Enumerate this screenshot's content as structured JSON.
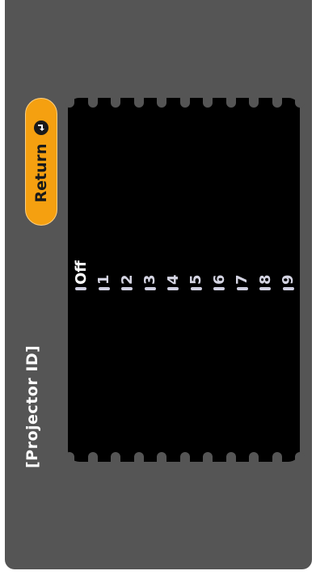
{
  "screen": {
    "title": "[Projector ID]",
    "return_button": {
      "label": "Return",
      "icon": "enter-icon"
    },
    "list": {
      "selected": "Off",
      "items": [
        {
          "label": "Off",
          "selected": true
        },
        {
          "label": "1",
          "selected": false
        },
        {
          "label": "2",
          "selected": false
        },
        {
          "label": "3",
          "selected": false
        },
        {
          "label": "4",
          "selected": false
        },
        {
          "label": "5",
          "selected": false
        },
        {
          "label": "6",
          "selected": false
        },
        {
          "label": "7",
          "selected": false
        },
        {
          "label": "8",
          "selected": false
        },
        {
          "label": "9",
          "selected": false
        }
      ]
    }
  },
  "colors": {
    "background": "#555555",
    "list_background": "#000000",
    "accent": "#f5a010",
    "text": "#ffffff"
  }
}
